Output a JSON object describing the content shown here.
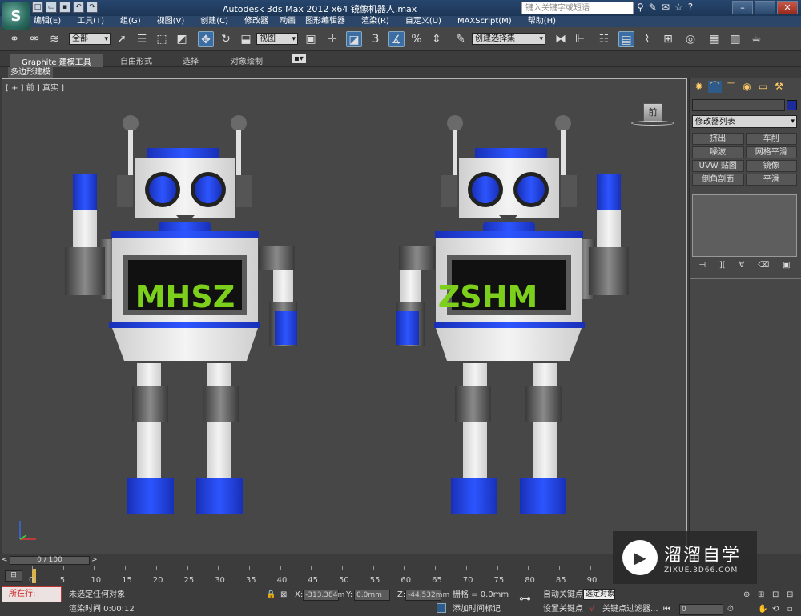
{
  "app": {
    "title": "Autodesk 3ds Max  2012 x64      镜像机器人.max",
    "search_placeholder": "键入关键字或短语",
    "logo_letter": "S"
  },
  "menu": [
    "编辑(E)",
    "工具(T)",
    "组(G)",
    "视图(V)",
    "创建(C)",
    "修改器",
    "动画",
    "图形编辑器",
    "渲染(R)",
    "自定义(U)",
    "MAXScript(M)",
    "帮助(H)"
  ],
  "toolbar": {
    "selection_filter": "全部",
    "ref_coord": "视图",
    "snap_label": "3",
    "named_selection": "创建选择集"
  },
  "ribbon": {
    "tabs": [
      "Graphite 建模工具",
      "自由形式",
      "选择",
      "对象绘制"
    ],
    "sub_label": "多边形建模"
  },
  "viewport": {
    "label": "[ + ] 前 ] 真实 ]",
    "viewcube_label": "前",
    "screen_text_left": "MHSZ",
    "screen_text_right": "ZSHM"
  },
  "command_panel": {
    "modifier_list": "修改器列表",
    "modifier_buttons": [
      "挤出",
      "车削",
      "噪波",
      "网格平滑",
      "UVW 贴图",
      "镜像",
      "倒角剖面",
      "平滑"
    ]
  },
  "timeline": {
    "slider_text": "0 / 100",
    "ticks": [
      "0",
      "5",
      "10",
      "15",
      "20",
      "25",
      "30",
      "35",
      "40",
      "45",
      "50",
      "55",
      "60",
      "65",
      "70",
      "75",
      "80",
      "85",
      "90"
    ]
  },
  "status": {
    "maxscript_label": "所在行:",
    "selection_text": "未选定任何对象",
    "render_time": "渲染时间  0:00:12",
    "x_label": "X:",
    "x_value": "-313.384m",
    "y_label": "Y:",
    "y_value": "0.0mm",
    "z_label": "Z:",
    "z_value": "-44.532mm",
    "grid": "栅格 = 0.0mm",
    "add_time_tag": "添加时间标记",
    "auto_key": "自动关键点",
    "set_key": "设置关键点",
    "selected_object": "选定对象",
    "key_filters": "关键点过滤器...",
    "frame_value": "0"
  },
  "watermark": {
    "brand": "溜溜自学",
    "url": "ZIXUE.3D66.COM"
  },
  "colors": {
    "robot_blue": "#1e3fd8",
    "robot_white": "#e8e8e8",
    "screen_green": "#7ccf1a",
    "viewport_bg": "#474747"
  }
}
